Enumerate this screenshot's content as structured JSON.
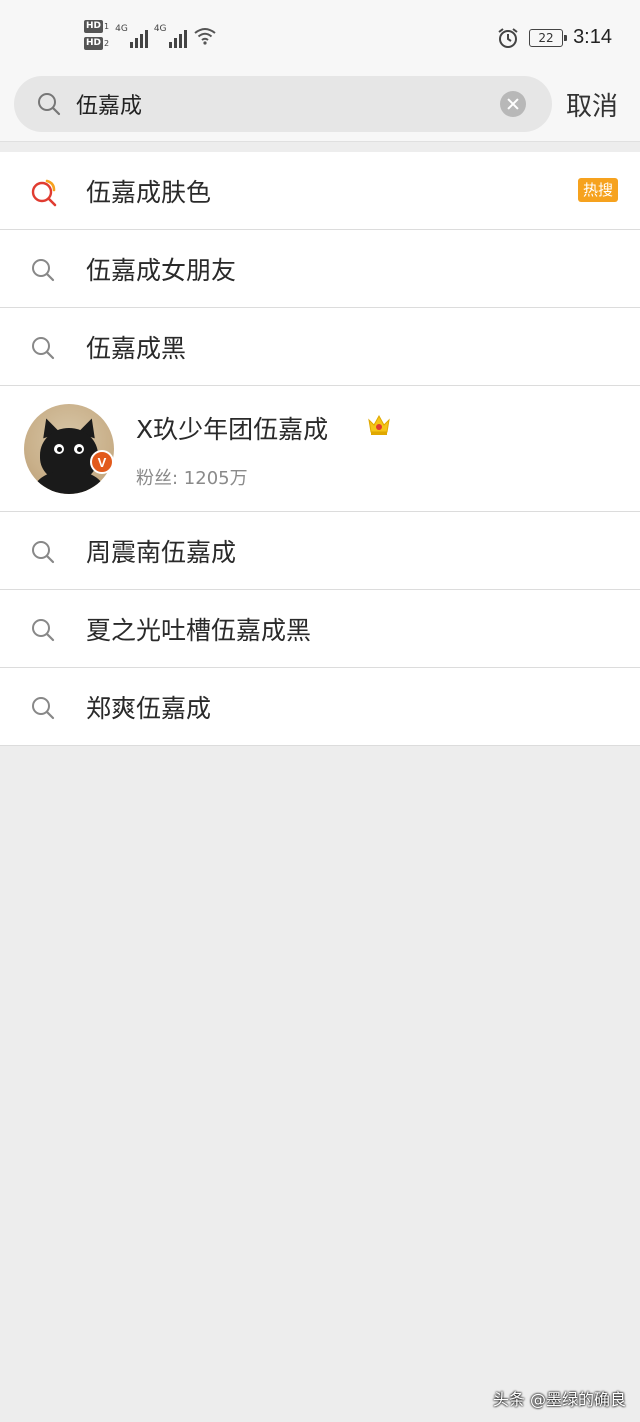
{
  "status_bar": {
    "hd1": "HD",
    "hd1_num": "1",
    "hd2": "HD",
    "hd2_num": "2",
    "signal1_label": "4G",
    "signal2_label": "4G",
    "battery": "22",
    "time": "3:14"
  },
  "search": {
    "query": "伍嘉成",
    "cancel_label": "取消"
  },
  "suggestions_top": [
    {
      "text": "伍嘉成肤色",
      "badge": "热搜",
      "icon": "hot-search-icon"
    },
    {
      "text": "伍嘉成女朋友",
      "icon": "search-icon"
    },
    {
      "text": "伍嘉成黑",
      "icon": "search-icon"
    }
  ],
  "user_result": {
    "name": "X玖少年团伍嘉成",
    "followers_label": "粉丝: 1205万",
    "verified_mark": "V",
    "icon": "crown-icon"
  },
  "suggestions_bottom": [
    {
      "text": "周震南伍嘉成",
      "icon": "search-icon"
    },
    {
      "text": "夏之光吐槽伍嘉成黑",
      "icon": "search-icon"
    },
    {
      "text": "郑爽伍嘉成",
      "icon": "search-icon"
    }
  ],
  "watermark": "头条 @墨绿的确良",
  "colors": {
    "hot_badge": "#f6a21e",
    "verify_badge": "#e25a1c",
    "background": "#ededed"
  }
}
